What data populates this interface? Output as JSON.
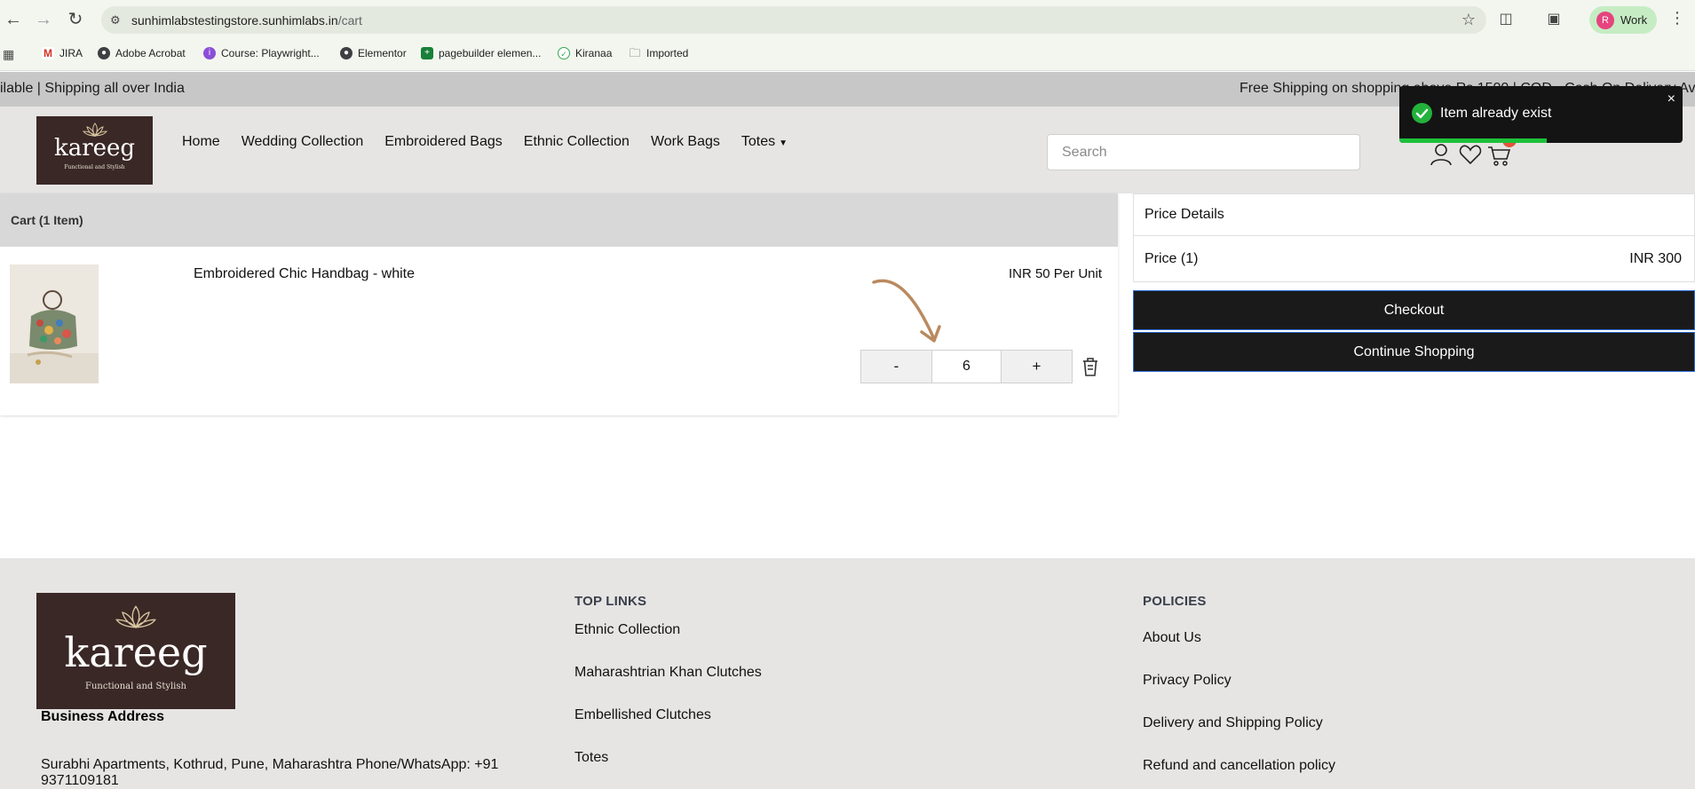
{
  "browser": {
    "url_host": "sunhimlabstestingstore.sunhimlabs.in",
    "url_path": "/cart",
    "profile_initial": "R",
    "profile_label": "Work",
    "bookmarks": [
      {
        "label": "JIRA",
        "icon": "gmail-icon"
      },
      {
        "label": "Adobe Acrobat",
        "icon": "globe-icon"
      },
      {
        "label": "Course: Playwright...",
        "icon": "course-icon"
      },
      {
        "label": "Elementor",
        "icon": "globe-icon"
      },
      {
        "label": "pagebuilder elemen...",
        "icon": "sheets-icon"
      },
      {
        "label": "Kiranaa",
        "icon": "check-circle-icon"
      },
      {
        "label": "Imported",
        "icon": "folder-icon"
      }
    ]
  },
  "announcement": {
    "left_text": "ilable | Shipping all over India",
    "right_text": "Free Shipping on shopping above Rs 1500 | COD - Cash On Delivery Av"
  },
  "header": {
    "logo_word": "kareeg",
    "logo_tagline": "Functional and Stylish",
    "menu": [
      "Home",
      "Wedding Collection",
      "Embroidered Bags",
      "Ethnic Collection",
      "Work Bags",
      "Totes"
    ],
    "search_placeholder": "Search",
    "cart_count": "1"
  },
  "cart": {
    "heading": "Cart (1 Item)",
    "items": [
      {
        "name": "Embroidered Chic Handbag - white",
        "unit_price": "INR 50 Per Unit",
        "quantity": "6"
      }
    ],
    "minus_label": "-",
    "plus_label": "+"
  },
  "price_details": {
    "title": "Price Details",
    "price_label": "Price (1)",
    "price_value": "INR 300",
    "checkout_label": "Checkout",
    "continue_label": "Continue Shopping"
  },
  "toast": {
    "message": "Item already exist",
    "close": "×",
    "progress": 0.52
  },
  "footer": {
    "logo_word": "kareeg",
    "logo_tagline": "Functional and Stylish",
    "business_title": "Business Address",
    "business_address": "Surabhi Apartments, Kothrud, Pune, Maharashtra Phone/WhatsApp: +91 9371109181",
    "top_links_title": "TOP LINKS",
    "top_links": [
      "Ethnic Collection",
      "Maharashtrian Khan Clutches",
      "Embellished Clutches",
      "Totes"
    ],
    "policies_title": "POLICIES",
    "policies": [
      "About Us",
      "Privacy Policy",
      "Delivery and Shipping Policy",
      "Refund and cancellation policy"
    ]
  },
  "colors": {
    "brand_dark": "#3a2826",
    "button_dark": "#1a1a1a",
    "toast_green": "#23b23c",
    "cart_badge": "#e5533d"
  }
}
